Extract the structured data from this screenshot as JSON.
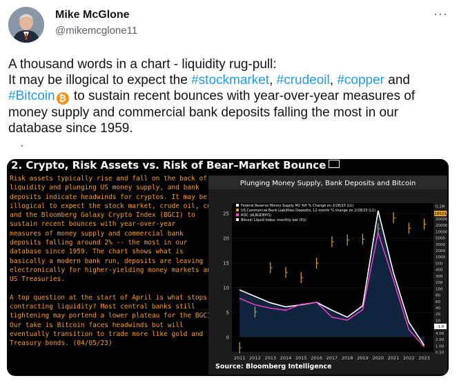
{
  "author": {
    "name": "Mike McGlone",
    "handle": "@mikemcglone11"
  },
  "more_icon": "more-horizontal-icon",
  "tweet": {
    "line1": "A thousand words in a chart - liquidity rug-pull:",
    "line2_prefix": "It may be illogical to expect the ",
    "tag_stockmarket": "#stockmarket",
    "comma1": ", ",
    "tag_crudeoil": "#crudeoil",
    "comma2": ", ",
    "tag_copper": "#copper",
    "and": " and",
    "tag_bitcoin": "#Bitcoin",
    "bitcoin_emoji": "₿",
    "line3_suffix": " to sustain recent bounces with year-over-year measures of",
    "line4": "money supply and commercial bank deposits falling the most in our",
    "line5": "database since 1959."
  },
  "media": {
    "header": "2. Crypto, Risk Assets vs. Risk of Bear–Market Bounce",
    "body_lines": [
      "Risk assets typically rise and fall on the back of",
      "liquidity and plunging US money supply, and bank",
      "deposits indicate headwinds for cryptos. It may be",
      "illogical to expect the stock market, crude oil, copper",
      "and the Bloomberg Galaxy Crypto Index (BGCI) to",
      "sustain recent bounces with year-over-year",
      "measures of money supply and commercial bank",
      "deposits falling around 2% -- the most in our",
      "database since 1959. The chart shows what is",
      "basically a modern bank run, deposits are leaving",
      "electronically for higher-yielding money markets and",
      "US Treasuries.",
      "",
      "A top question at the start of April is what stops",
      "contracting liquidity? Most central banks still",
      "tightening may portend a lower plateau for the BGCI.",
      "Our take is Bitcoin faces headwinds but will",
      "eventually transition to trade more like gold and",
      "Treasury bonds. (04/05/23)"
    ]
  },
  "chart_data": {
    "type": "line",
    "title": "Plunging Money Supply, Bank Deposits and Bitcoin",
    "source": "Source: Bloomberg Intelligence",
    "legend": [
      "Federal Reserve Money Supply M2 YoY % Change on 2/28/23 (L1)",
      "US Commercial Bank Liabilities Deposits, 12-month % change on 2/28/23 (L1)",
      "ROC (ALNUDEPO)",
      "Bitcoin Liquid Index, monthly bar (R1)"
    ],
    "legend_colors": [
      "#ffffff",
      "#e8a020",
      "#ff3fd0",
      "#ffffff"
    ],
    "legend_position": "top-left",
    "x": [
      2011,
      2012,
      2013,
      2014,
      2015,
      2016,
      2017,
      2018,
      2019,
      2020,
      2021,
      2022,
      2023
    ],
    "left_ticks": [
      "25",
      "20",
      "15",
      "10",
      "5",
      "0"
    ],
    "left_ylim": [
      -3,
      27
    ],
    "right_ticks": [
      "0.1M",
      "50000",
      "30000",
      "20000",
      "10000",
      "5000",
      "3000",
      "2000",
      "1000",
      "500",
      "400",
      "300",
      "200",
      "100",
      "80",
      "60",
      "40",
      "20",
      "10",
      "6.00",
      "4.00",
      "2.00",
      "1.00",
      "0.50"
    ],
    "right_markers": [
      "28523",
      "-1.0"
    ],
    "series": [
      {
        "name": "Federal Reserve Money Supply M2 YoY % Change on 2/28/23 (L1)",
        "color": "#ffffff",
        "fill": "#0f2740",
        "values": [
          9.5,
          8.2,
          6.9,
          6.1,
          6.5,
          7.0,
          5.4,
          4.0,
          6.3,
          25.5,
          13.0,
          3.0,
          -1.7
        ]
      },
      {
        "name": "ROC (ALNUDEPO)",
        "color": "#ff3fd0",
        "values": [
          7.8,
          6.5,
          5.8,
          5.4,
          6.6,
          7.0,
          4.0,
          3.4,
          5.5,
          21.0,
          11.5,
          1.5,
          -2.0
        ]
      },
      {
        "name": "Bitcoin Liquid Index, monthly bar (R1)",
        "color": "#e8a020",
        "log_values": [
          0.5,
          12,
          600,
          400,
          250,
          900,
          6000,
          7000,
          7500,
          19000,
          50000,
          20000,
          28523
        ]
      }
    ]
  }
}
